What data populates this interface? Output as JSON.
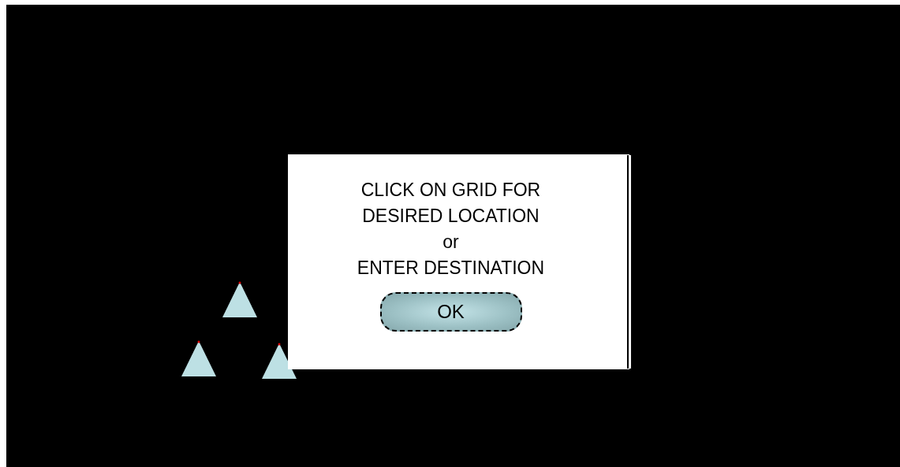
{
  "dialog": {
    "message_lines": [
      "CLICK ON GRID FOR",
      "DESIRED LOCATION",
      "or",
      "ENTER DESTINATION"
    ],
    "button": "OK"
  }
}
